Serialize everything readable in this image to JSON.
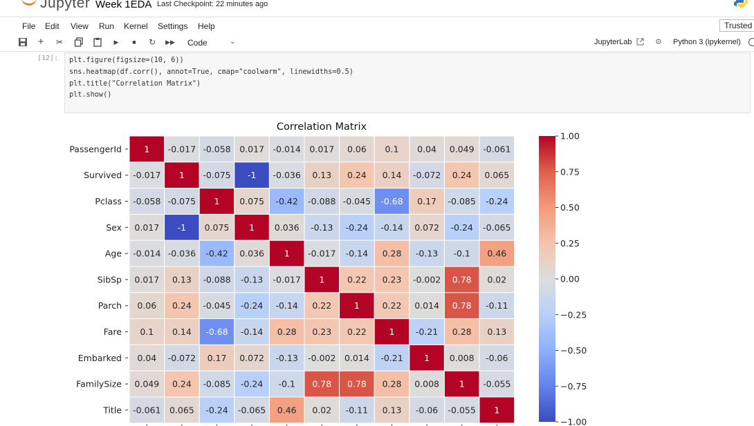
{
  "header": {
    "brand": "Jupyter",
    "notebook_title": "Week 1EDA",
    "checkpoint": "Last Checkpoint: 22 minutes ago"
  },
  "menu": [
    "File",
    "Edit",
    "View",
    "Run",
    "Kernel",
    "Settings",
    "Help"
  ],
  "trusted_label": "Trusted",
  "toolbar": {
    "cell_type": "Code",
    "jupyterlab_label": "JupyterLab",
    "kernel_label": "Python 3 (ipykernel)"
  },
  "cell": {
    "prompt": "[12]:",
    "code_lines": [
      "plt.figure(figsize=(10, 6))",
      "sns.heatmap(df.corr(), annot=True, cmap=\"coolwarm\", linewidths=0.5)",
      "plt.title(\"Correlation Matrix\")",
      "plt.show()"
    ]
  },
  "chart_data": {
    "type": "heatmap",
    "title": "Correlation Matrix",
    "labels": [
      "PassengerId",
      "Survived",
      "Pclass",
      "Sex",
      "Age",
      "SibSp",
      "Parch",
      "Fare",
      "Embarked",
      "FamilySize",
      "Title"
    ],
    "matrix": [
      [
        1,
        -0.017,
        -0.058,
        0.017,
        -0.014,
        0.017,
        0.06,
        0.1,
        0.04,
        0.049,
        -0.061
      ],
      [
        -0.017,
        1,
        -0.075,
        -1,
        -0.036,
        0.13,
        0.24,
        0.14,
        -0.072,
        0.24,
        0.065
      ],
      [
        -0.058,
        -0.075,
        1,
        0.075,
        -0.42,
        -0.088,
        -0.045,
        -0.68,
        0.17,
        -0.085,
        -0.24
      ],
      [
        0.017,
        -1,
        0.075,
        1,
        0.036,
        -0.13,
        -0.24,
        -0.14,
        0.072,
        -0.24,
        -0.065
      ],
      [
        -0.014,
        -0.036,
        -0.42,
        0.036,
        1,
        -0.017,
        -0.14,
        0.28,
        -0.13,
        -0.1,
        0.46
      ],
      [
        0.017,
        0.13,
        -0.088,
        -0.13,
        -0.017,
        1,
        0.22,
        0.23,
        -0.002,
        0.78,
        0.02
      ],
      [
        0.06,
        0.24,
        -0.045,
        -0.24,
        -0.14,
        0.22,
        1,
        0.22,
        0.014,
        0.78,
        -0.11
      ],
      [
        0.1,
        0.14,
        -0.68,
        -0.14,
        0.28,
        0.23,
        0.22,
        1,
        -0.21,
        0.28,
        0.13
      ],
      [
        0.04,
        -0.072,
        0.17,
        0.072,
        -0.13,
        -0.002,
        0.014,
        -0.21,
        1,
        0.008,
        -0.06
      ],
      [
        0.049,
        0.24,
        -0.085,
        -0.24,
        -0.1,
        0.78,
        0.78,
        0.28,
        0.008,
        1,
        -0.055
      ],
      [
        -0.061,
        0.065,
        -0.24,
        -0.065,
        0.46,
        0.02,
        -0.11,
        0.13,
        -0.06,
        -0.055,
        1
      ]
    ],
    "cell_labels": [
      [
        "1",
        "-0.017",
        "-0.058",
        "0.017",
        "-0.014",
        "0.017",
        "0.06",
        "0.1",
        "0.04",
        "0.049",
        "-0.061"
      ],
      [
        "-0.017",
        "1",
        "-0.075",
        "-1",
        "-0.036",
        "0.13",
        "0.24",
        "0.14",
        "-0.072",
        "0.24",
        "0.065"
      ],
      [
        "-0.058",
        "-0.075",
        "1",
        "0.075",
        "-0.42",
        "-0.088",
        "-0.045",
        "-0.68",
        "0.17",
        "-0.085",
        "-0.24"
      ],
      [
        "0.017",
        "-1",
        "0.075",
        "1",
        "0.036",
        "-0.13",
        "-0.24",
        "-0.14",
        "0.072",
        "-0.24",
        "-0.065"
      ],
      [
        "-0.014",
        "-0.036",
        "-0.42",
        "0.036",
        "1",
        "-0.017",
        "-0.14",
        "0.28",
        "-0.13",
        "-0.1",
        "0.46"
      ],
      [
        "0.017",
        "0.13",
        "-0.088",
        "-0.13",
        "-0.017",
        "1",
        "0.22",
        "0.23",
        "-0.002",
        "0.78",
        "0.02"
      ],
      [
        "0.06",
        "0.24",
        "-0.045",
        "-0.24",
        "-0.14",
        "0.22",
        "1",
        "0.22",
        "0.014",
        "0.78",
        "-0.11"
      ],
      [
        "0.1",
        "0.14",
        "-0.68",
        "-0.14",
        "0.28",
        "0.23",
        "0.22",
        "1",
        "-0.21",
        "0.28",
        "0.13"
      ],
      [
        "0.04",
        "-0.072",
        "0.17",
        "0.072",
        "-0.13",
        "-0.002",
        "0.014",
        "-0.21",
        "1",
        "0.008",
        "-0.06"
      ],
      [
        "0.049",
        "0.24",
        "-0.085",
        "-0.24",
        "-0.1",
        "0.78",
        "0.78",
        "0.28",
        "0.008",
        "1",
        "-0.055"
      ],
      [
        "-0.061",
        "0.065",
        "-0.24",
        "-0.065",
        "0.46",
        "0.02",
        "-0.11",
        "0.13",
        "-0.06",
        "-0.055",
        "1"
      ]
    ],
    "colorbar_ticks": [
      "1.00",
      "0.75",
      "0.50",
      "0.25",
      "0.00",
      "−0.25",
      "−0.50",
      "−0.75",
      "−1.00"
    ],
    "vmin": -1,
    "vmax": 1,
    "cmap": "coolwarm"
  }
}
